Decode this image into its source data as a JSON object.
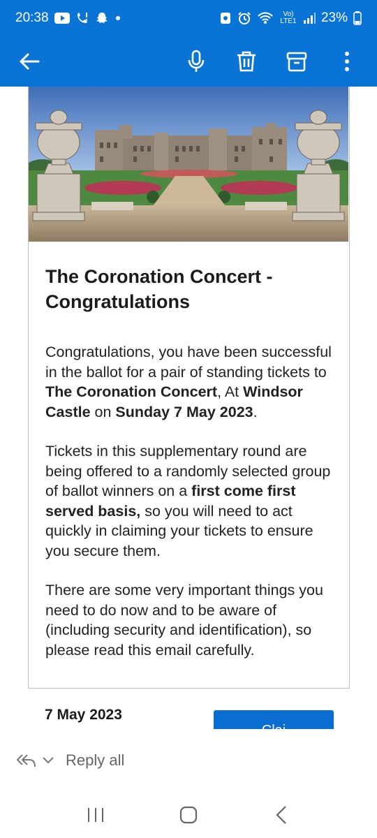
{
  "status_bar": {
    "time": "20:38",
    "volte_label": "Vo) LTE1",
    "battery_text": "23%",
    "icons": [
      "youtube-icon",
      "phone-notification-icon",
      "snapchat-icon",
      "dot-icon",
      "sim-icon",
      "alarm-icon",
      "wifi-icon",
      "signal-icon",
      "battery-icon"
    ]
  },
  "toolbar": {
    "back_icon": "back-arrow-icon",
    "actions": [
      "microphone-icon",
      "delete-icon",
      "archive-icon",
      "more-icon"
    ]
  },
  "email": {
    "hero_image": "Windsor Castle East Terrace garden with stone urns",
    "title": "The Coronation Concert - Congratulations",
    "para1": {
      "t1": "Congratulations, you have been successful in the ballot for a pair of standing tickets to ",
      "b1": "The Coronation Concert",
      "t2": ", At ",
      "b2": "Windsor Castle",
      "t3": " on ",
      "b3": "Sunday 7 May 2023",
      "t4": "."
    },
    "para2": {
      "t1": "Tickets in this supplementary round are being offered to a randomly selected group of ballot winners on a ",
      "b1": "first come first served basis,",
      "t2": " so you will need to act quickly in claiming your tickets to ensure you secure them."
    },
    "para3": "There are some very important things you need to do now and to be aware of (including security and identification), so please read this email carefully.",
    "date_heading": "7 May 2023",
    "claim_button_partial": "Clai"
  },
  "reply_bar": {
    "label": "Reply all"
  },
  "colors": {
    "accent": "#0a74d6",
    "button": "#0a6ed1",
    "card_border": "#bdbdbd"
  }
}
